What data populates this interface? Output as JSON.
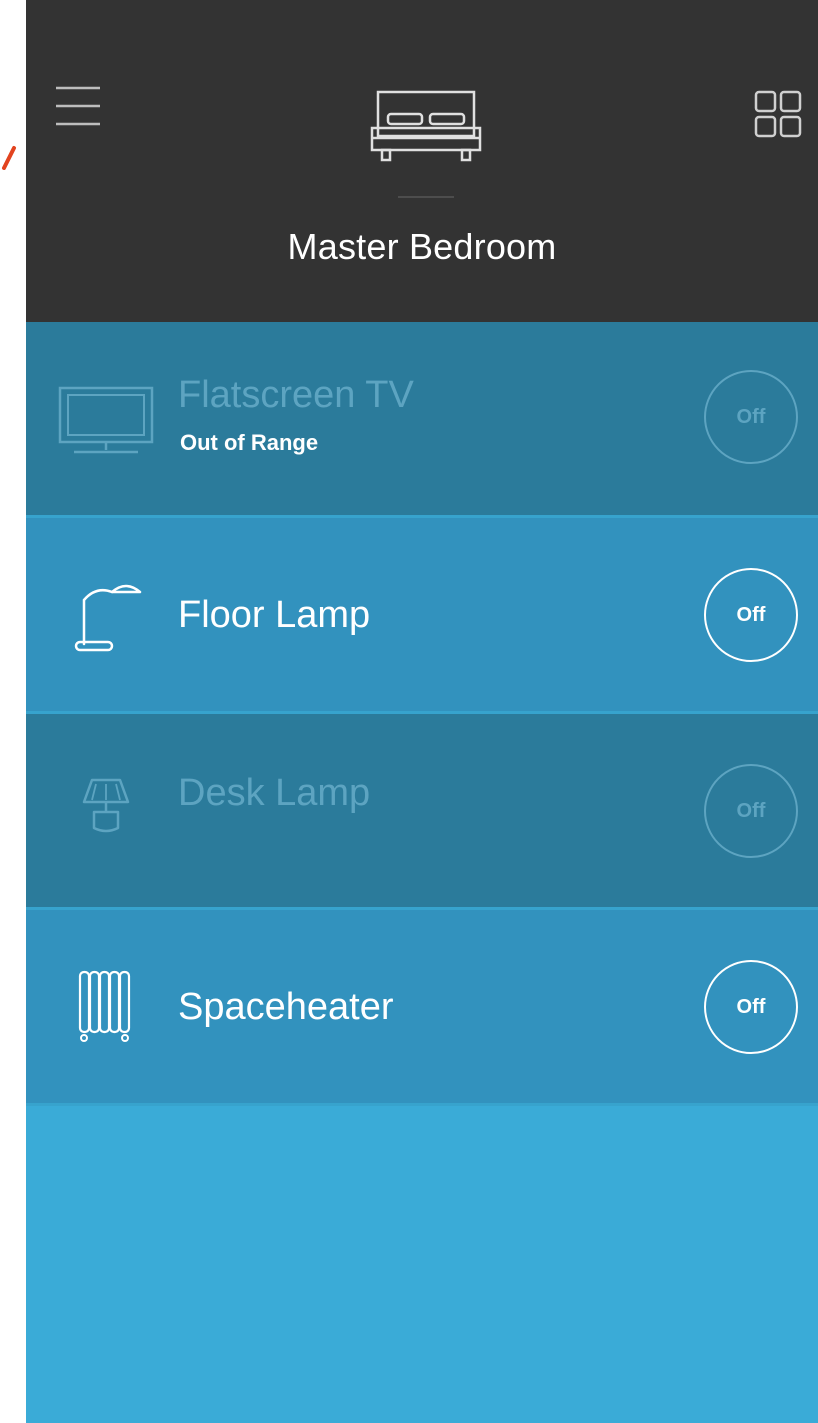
{
  "header": {
    "room_title": "Master Bedroom",
    "menu_icon": "hamburger-menu-icon",
    "room_icon": "bed-icon",
    "grid_icon": "grid-view-icon"
  },
  "devices": [
    {
      "name": "Flatscreen TV",
      "status": "Out of Range",
      "toggle_label": "Off",
      "icon": "tv-icon",
      "available": false
    },
    {
      "name": "Floor Lamp",
      "status": "",
      "toggle_label": "Off",
      "icon": "floor-lamp-icon",
      "available": true
    },
    {
      "name": "Desk Lamp",
      "status": "",
      "toggle_label": "Off",
      "icon": "desk-lamp-icon",
      "available": false
    },
    {
      "name": "Spaceheater",
      "status": "",
      "toggle_label": "Off",
      "icon": "space-heater-icon",
      "available": true
    }
  ],
  "colors": {
    "header_bg": "#333333",
    "list_bg": "#3aabd7",
    "row_active": "#3292be",
    "row_inactive": "#2b7b9b",
    "inactive_text": "#5da4c1",
    "edge_accent": "#e2431f"
  }
}
